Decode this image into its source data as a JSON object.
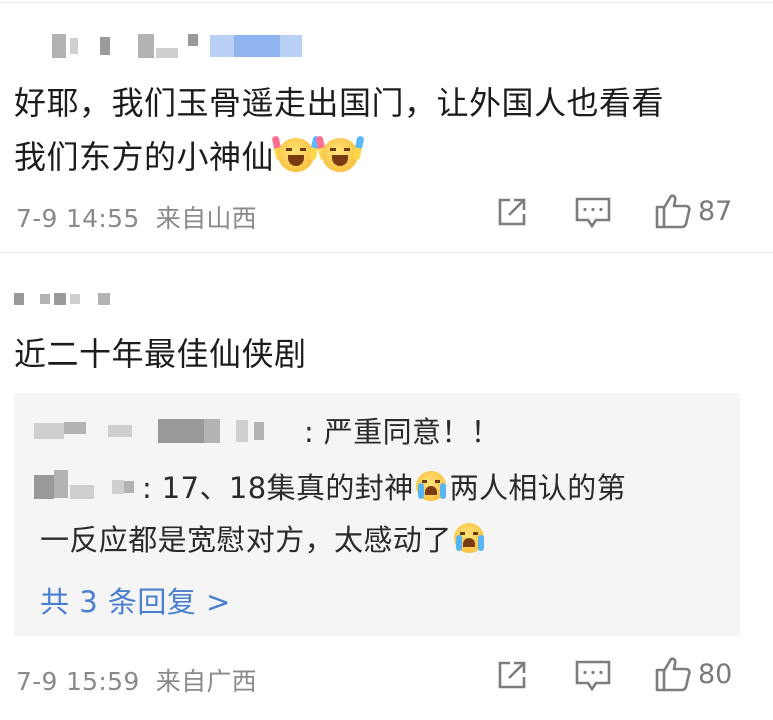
{
  "comments": [
    {
      "text_line1": "好耶，我们玉骨遥走出国门，让外国人也看看",
      "text_line2": "我们东方的小神仙",
      "emojis": [
        "cheer-emoji",
        "cheer-emoji"
      ],
      "time": "7-9 14:55",
      "location": "来自山西",
      "like_count": "87"
    },
    {
      "text": "近二十年最佳仙侠剧",
      "replies": [
        {
          "text": "严重同意！！"
        },
        {
          "text_line1": "17、18集真的封神",
          "text_line1_tail": "两人相认的第",
          "text_line2": "一反应都是宽慰对方，太感动了"
        }
      ],
      "more_replies": "共 3 条回复 >",
      "time": "7-9 15:59",
      "location": "来自广西",
      "like_count": "80"
    }
  ],
  "icons": {
    "share": "share-icon",
    "comment": "comment-icon",
    "like": "thumbs-up-icon",
    "cry_emoji": "crying-emoji"
  },
  "colors": {
    "text": "#1c1c1c",
    "meta": "#8a8a8a",
    "link": "#4a7fd0",
    "reply_bg": "#f5f5f5"
  }
}
